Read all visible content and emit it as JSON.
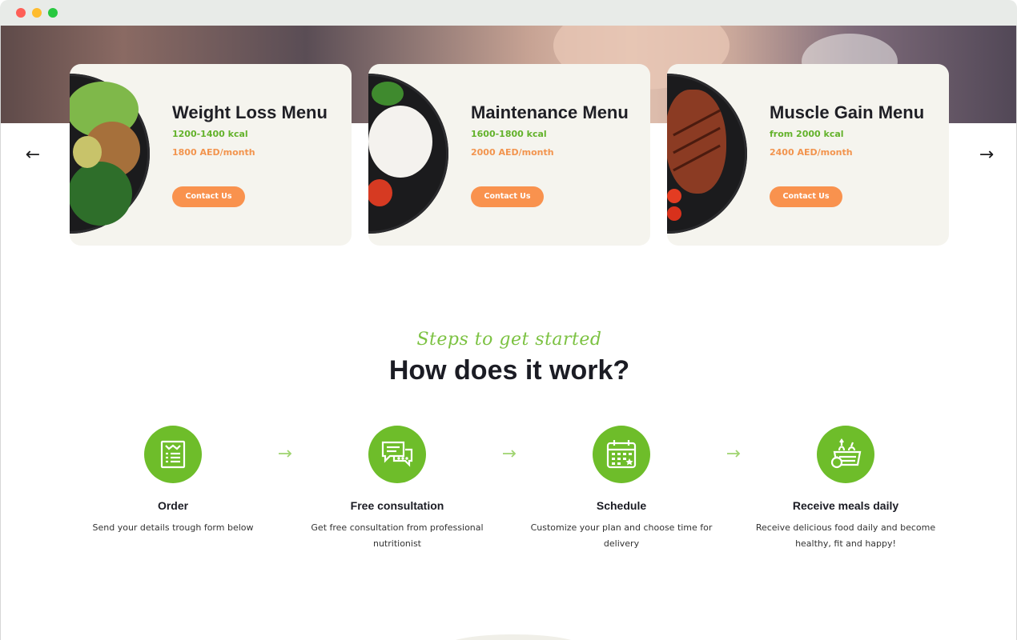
{
  "carousel": {
    "prev_label": "←",
    "next_label": "→",
    "cards": [
      {
        "title": "Weight Loss Menu",
        "kcal": "1200-1400 kcal",
        "price": "1800 AED/month",
        "button": "Contact Us",
        "image": "salad-plate"
      },
      {
        "title": "Maintenance Menu",
        "kcal": "1600-1800 kcal",
        "price": "2000 AED/month",
        "button": "Contact Us",
        "image": "rice-plate"
      },
      {
        "title": "Muscle Gain Menu",
        "kcal": "from 2000 kcal",
        "price": "2400 AED/month",
        "button": "Contact Us",
        "image": "steak-plate"
      }
    ]
  },
  "how": {
    "kicker": "Steps to get started",
    "title": "How does it work?",
    "steps": [
      {
        "icon": "order-form-icon",
        "title": "Order",
        "desc": "Send your details trough form below"
      },
      {
        "icon": "chat-bubbles-icon",
        "title": "Free consultation",
        "desc": "Get free consultation from professional nutritionist"
      },
      {
        "icon": "calendar-icon",
        "title": "Schedule",
        "desc": "Customize your plan and choose time for delivery"
      },
      {
        "icon": "food-basket-icon",
        "title": "Receive meals daily",
        "desc": "Receive delicious food daily and become healthy, fit and happy!"
      }
    ]
  },
  "colors": {
    "accent_green": "#6ebd2a",
    "accent_orange": "#f9924e",
    "card_bg": "#f5f4ee",
    "heading": "#1b1c24"
  }
}
